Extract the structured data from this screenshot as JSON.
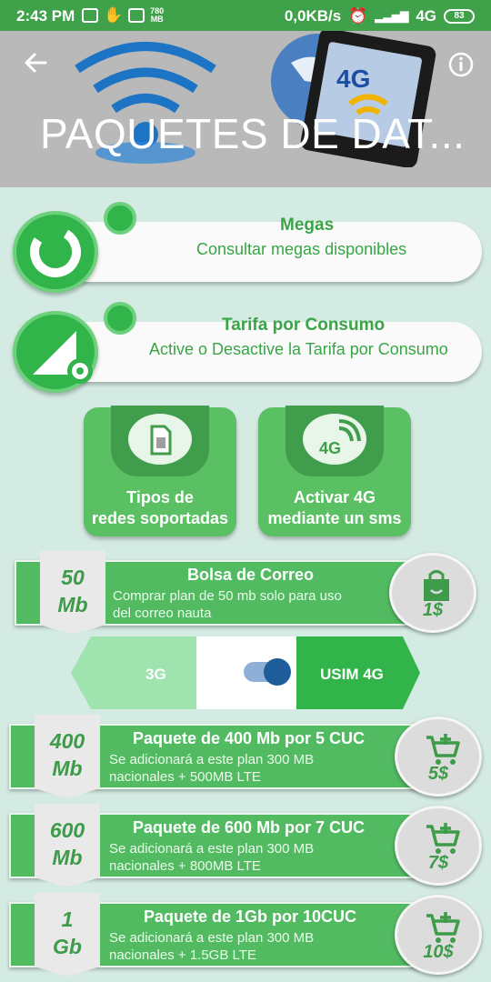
{
  "status": {
    "time": "2:43 PM",
    "data_amount": "780",
    "data_unit": "MB",
    "speed": "0,0KB/s",
    "network": "4G",
    "battery": "83"
  },
  "header": {
    "title": "PAQUETES DE DAT...",
    "art_label": "4G"
  },
  "cards": [
    {
      "title": "Megas",
      "subtitle": "Consultar megas disponibles",
      "icon": "donut-chart-icon"
    },
    {
      "title": "Tarifa por Consumo",
      "subtitle": "Active o Desactive la Tarifa por Consumo",
      "icon": "signal-gear-icon"
    }
  ],
  "buttons": [
    {
      "line1": "Tipos de",
      "line2": "redes soportadas",
      "icon": "sim-card-icon"
    },
    {
      "line1": "Activar 4G",
      "line2": "mediante un sms",
      "icon": "4g-signal-icon",
      "icon_text": "4G"
    }
  ],
  "mail_plan": {
    "size1": "50",
    "size2": "Mb",
    "title": "Bolsa de Correo",
    "desc1": "Comprar plan de 50 mb solo para uso",
    "desc2": "del correo nauta",
    "price": "1$",
    "icon": "shopping-bag-icon"
  },
  "network_toggle": {
    "left": "3G",
    "right": "USIM 4G",
    "selected": "USIM 4G"
  },
  "plans": [
    {
      "size1": "400",
      "size2": "Mb",
      "title": "Paquete de 400 Mb por 5 CUC",
      "desc1": "Se adicionará a este plan 300 MB",
      "desc2": "nacionales + 500MB LTE",
      "price": "5$"
    },
    {
      "size1": "600",
      "size2": "Mb",
      "title": "Paquete de 600 Mb por 7 CUC",
      "desc1": "Se adicionará a este plan 300 MB",
      "desc2": "nacionales + 800MB LTE",
      "price": "7$"
    },
    {
      "size1": "1",
      "size2": "Gb",
      "title": "Paquete de 1Gb por 10CUC",
      "desc1": "Se adicionará a este plan 300 MB",
      "desc2": "nacionales + 1.5GB LTE",
      "price": "10$"
    }
  ],
  "colors": {
    "status_bar": "#3fa24b",
    "accent": "#31b44a",
    "background": "#d4ebe3",
    "toggle_knob": "#1f5d9a"
  }
}
